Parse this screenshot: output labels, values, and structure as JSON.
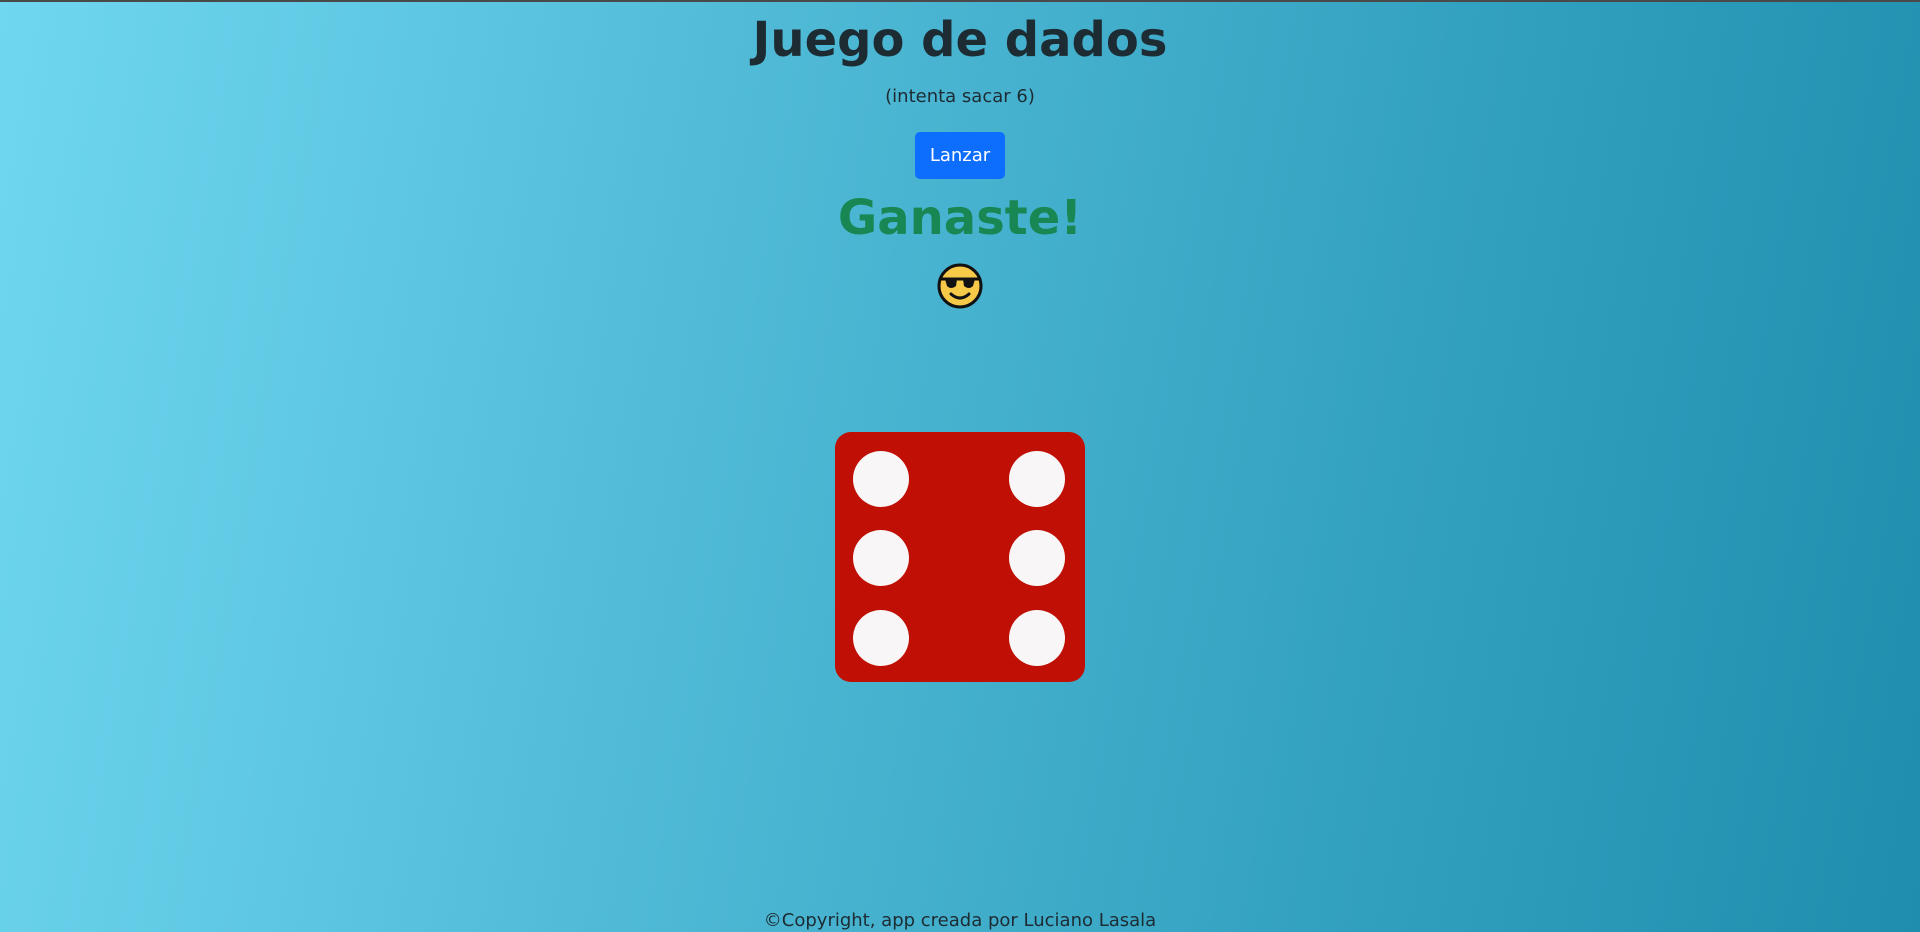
{
  "game": {
    "title": "Juego de dados",
    "subtitle": "(intenta sacar 6)",
    "roll_button_label": "Lanzar",
    "result_text": "Ganaste!",
    "result_icon": "sunglasses-smiley-icon",
    "die_value": 6,
    "die_color": "#c00f05",
    "pip_color": "#f8f6f7"
  },
  "footer": {
    "copyright": "©Copyright, app creada por Luciano Lasala"
  },
  "colors": {
    "button": "#0d6efd",
    "result": "#198754"
  }
}
